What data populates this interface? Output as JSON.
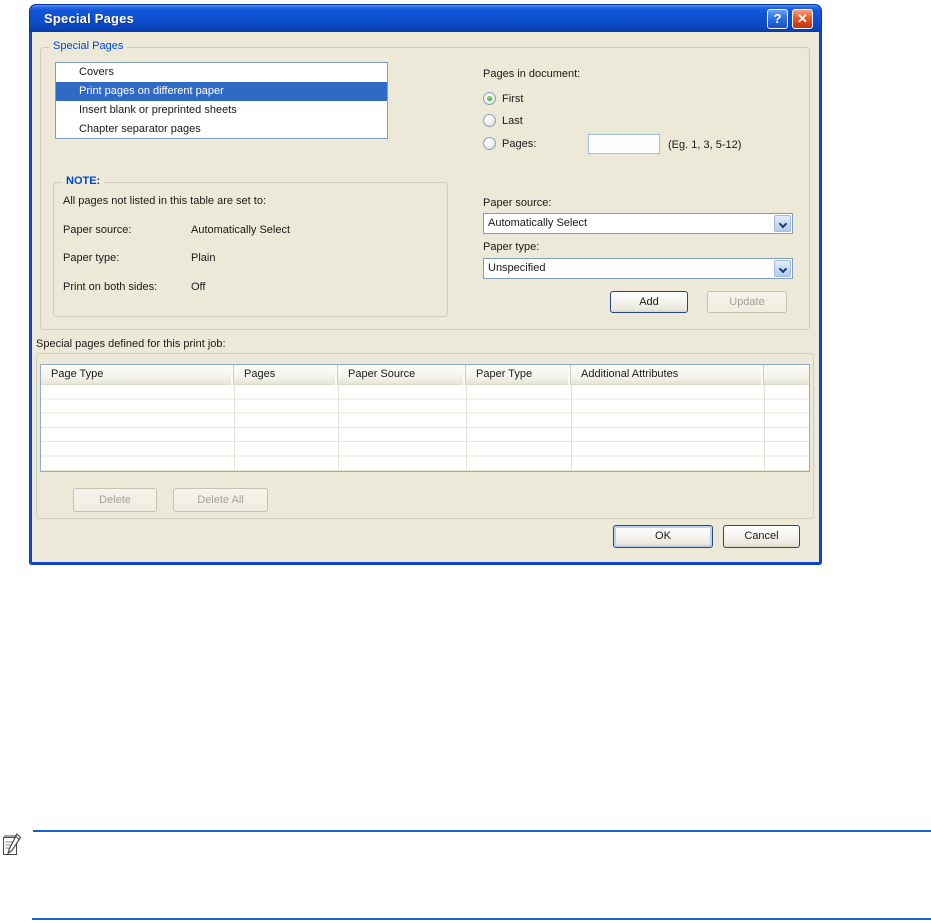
{
  "titlebar": {
    "title": "Special Pages",
    "help_icon": "?",
    "close_icon": "✕"
  },
  "special_pages_group": {
    "label": "Special Pages",
    "list": [
      {
        "label": "Covers",
        "selected": false
      },
      {
        "label": "Print pages on different paper",
        "selected": true
      },
      {
        "label": "Insert blank or preprinted sheets",
        "selected": false
      },
      {
        "label": "Chapter separator pages",
        "selected": false
      }
    ]
  },
  "pages_in_document": {
    "label": "Pages in document:",
    "first": "First",
    "last": "Last",
    "pages": "Pages:",
    "selected_option": "First",
    "pages_value": "",
    "pages_hint": "(Eg. 1, 3, 5-12)"
  },
  "note_group": {
    "label": "NOTE:",
    "intro": "All pages not listed in this table are set to:",
    "rows": [
      {
        "label": "Paper source:",
        "value": "Automatically Select"
      },
      {
        "label": "Paper type:",
        "value": "Plain"
      },
      {
        "label": "Print on both sides:",
        "value": "Off"
      }
    ]
  },
  "paper_source": {
    "label": "Paper source:",
    "value": "Automatically Select"
  },
  "paper_type": {
    "label": "Paper type:",
    "value": "Unspecified"
  },
  "actions": {
    "add": "Add",
    "update": "Update",
    "delete": "Delete",
    "delete_all": "Delete All",
    "ok": "OK",
    "cancel": "Cancel"
  },
  "jobs_table": {
    "caption": "Special pages defined for this print job:",
    "headers": [
      "Page Type",
      "Pages",
      "Paper Source",
      "Paper Type",
      "Additional Attributes"
    ],
    "rows": []
  },
  "colors": {
    "titlebar_blue": "#0d4ecf",
    "selection_blue": "#316ac5",
    "group_label_blue": "#0046d5",
    "dialog_bg": "#ece9d8",
    "footer_rule_blue": "#1463d8"
  }
}
